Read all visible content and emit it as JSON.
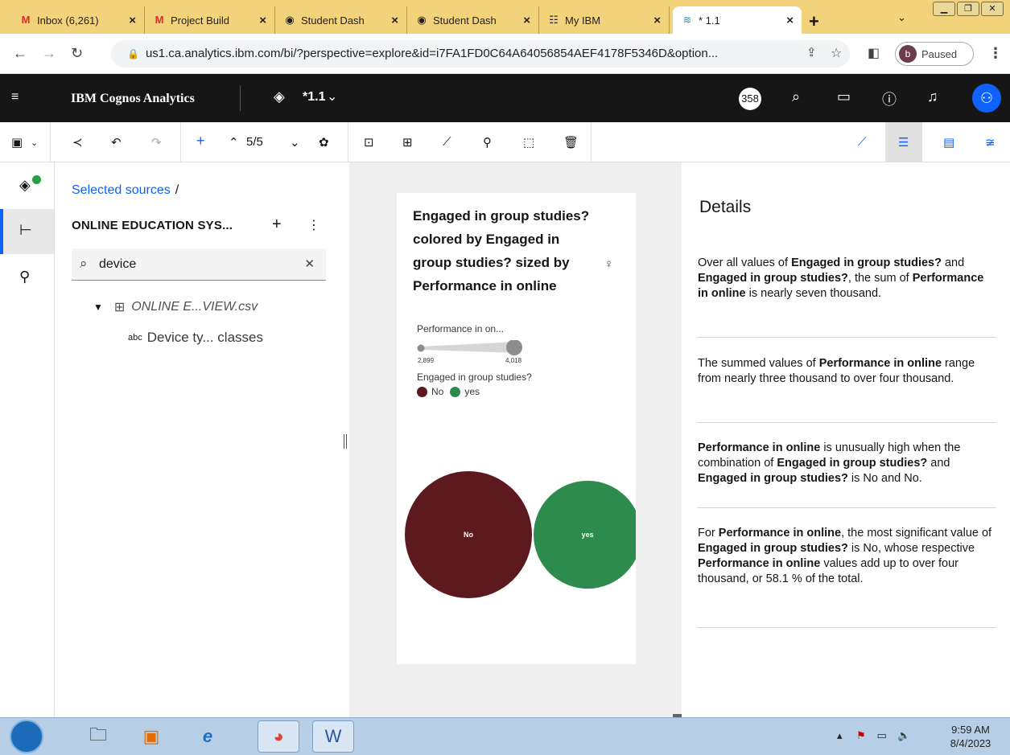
{
  "browser": {
    "tabs": [
      {
        "label": "Inbox (6,261)",
        "icon": "gmail-icon",
        "active": false
      },
      {
        "label": "Project Build",
        "icon": "gmail-icon",
        "active": false
      },
      {
        "label": "Student Dash",
        "icon": "globe-icon",
        "active": false
      },
      {
        "label": "Student Dash",
        "icon": "globe-icon",
        "active": false
      },
      {
        "label": "My IBM",
        "icon": "ibm-icon",
        "active": false
      },
      {
        "label": "* 1.1",
        "icon": "cognos-icon",
        "active": true
      }
    ],
    "url": "us1.ca.analytics.ibm.com/bi/?perspective=explore&id=i7FA1FD0C64A64056854AEF4178F5346D&option...",
    "profile_initial": "b",
    "profile_status": "Paused"
  },
  "header": {
    "brand": "IBM Cognos Analytics",
    "doc_title": "*1.1",
    "notification_count": "358"
  },
  "toolbar": {
    "page_indicator": "5/5"
  },
  "data_panel": {
    "breadcrumb": "Selected sources",
    "breadcrumb_sep": "/",
    "source_title": "ONLINE EDUCATION SYS...",
    "search_value": "device",
    "tree": {
      "file": "ONLINE E...VIEW.csv",
      "field_type": "abc",
      "field": "Device ty... classes"
    }
  },
  "card": {
    "title": "Engaged in group studies? colored by Engaged in group studies? sized by Performance in online",
    "size_legend_title": "Performance in on...",
    "size_min_label": "2,899",
    "size_max_label": "4,018",
    "color_legend_title": "Engaged in group studies?"
  },
  "chart_data": {
    "type": "bubble",
    "categories": [
      "No",
      "yes"
    ],
    "values": [
      4018,
      2899
    ],
    "colors": [
      "#5c1a1f",
      "#2e8b4e"
    ],
    "size_legend": {
      "min": 2899,
      "max": 4018
    },
    "legend": [
      {
        "label": "No",
        "color": "#5c1a1f"
      },
      {
        "label": "yes",
        "color": "#2e8b4e"
      }
    ]
  },
  "details": {
    "title": "Details",
    "items": [
      {
        "parts": [
          {
            "t": "Over all values of ",
            "b": false
          },
          {
            "t": "Engaged in group studies?",
            "b": true
          },
          {
            "t": " and ",
            "b": false
          },
          {
            "t": "Engaged in group studies?",
            "b": true
          },
          {
            "t": ", the sum of ",
            "b": false
          },
          {
            "t": "Performance in online",
            "b": true
          },
          {
            "t": " is nearly seven thousand.",
            "b": false
          }
        ]
      },
      {
        "parts": [
          {
            "t": "The summed values of ",
            "b": false
          },
          {
            "t": "Performance in online",
            "b": true
          },
          {
            "t": " range from nearly three thousand to over four thousand.",
            "b": false
          }
        ]
      },
      {
        "parts": [
          {
            "t": "Performance in online",
            "b": true
          },
          {
            "t": " is unusually high when the combination of ",
            "b": false
          },
          {
            "t": "Engaged in group studies?",
            "b": true
          },
          {
            "t": " and ",
            "b": false
          },
          {
            "t": "Engaged in group studies?",
            "b": true
          },
          {
            "t": " is No and No.",
            "b": false
          }
        ]
      },
      {
        "parts": [
          {
            "t": "For ",
            "b": false
          },
          {
            "t": "Performance in online",
            "b": true
          },
          {
            "t": ", the most significant value of ",
            "b": false
          },
          {
            "t": "Engaged in group studies?",
            "b": true
          },
          {
            "t": " is No, whose respective ",
            "b": false
          },
          {
            "t": "Performance in online",
            "b": true
          },
          {
            "t": " values add up to over four thousand, or 58.1 % of the total.",
            "b": false
          }
        ]
      }
    ]
  },
  "taskbar": {
    "time": "9:59 AM",
    "date": "8/4/2023"
  }
}
